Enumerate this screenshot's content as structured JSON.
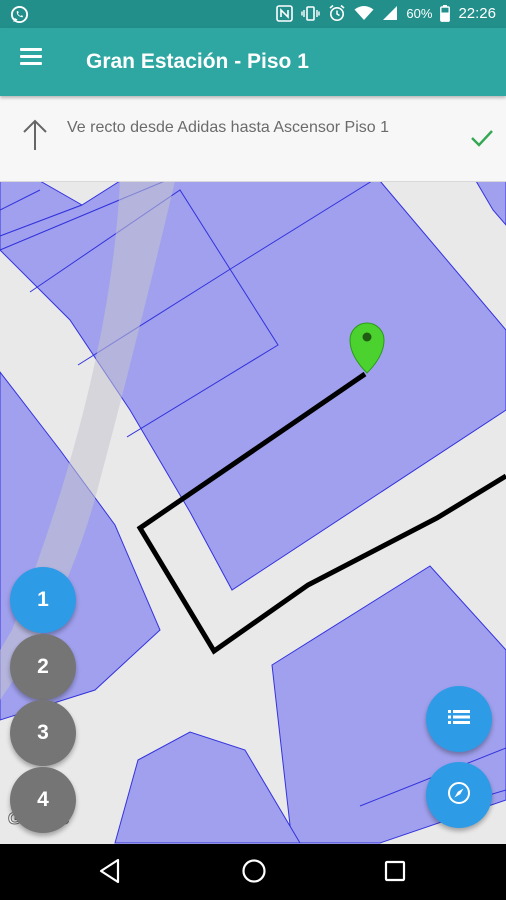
{
  "status_bar": {
    "battery": "60%",
    "time": "22:26",
    "icons": [
      "whatsapp-icon",
      "nfc-icon",
      "vibrate-icon",
      "alarm-icon",
      "wifi-icon",
      "signal-icon",
      "battery-icon"
    ]
  },
  "app_bar": {
    "title": "Gran Estación - Piso 1",
    "menu_icon": "hamburger-menu-icon"
  },
  "instruction": {
    "text": "Ve recto desde Adidas hasta Ascensor Piso 1",
    "direction_icon": "arrow-up-icon",
    "done_icon": "checkmark-icon"
  },
  "floors": {
    "buttons": [
      "1",
      "2",
      "3",
      "4"
    ],
    "selected": "1"
  },
  "map": {
    "attribution": "Google",
    "marker_icon": "location-pin-icon",
    "colors": {
      "room_fill": "#a0a0ee",
      "room_border": "#3333dd",
      "corridor": "#e9e9e9",
      "route": "#000000",
      "marker": "#4cd22f"
    }
  },
  "actions": {
    "list_icon": "list-icon",
    "compass_icon": "compass-icon"
  },
  "nav_bar": {
    "back_icon": "back-triangle-icon",
    "home_icon": "home-icon",
    "recents_icon": "recents-square-icon"
  },
  "colors": {
    "status_bar": "#238f8b",
    "app_bar": "#2ea7a2",
    "fab_active": "#2e9be6",
    "fab_inactive": "#757575",
    "check": "#35a853"
  }
}
